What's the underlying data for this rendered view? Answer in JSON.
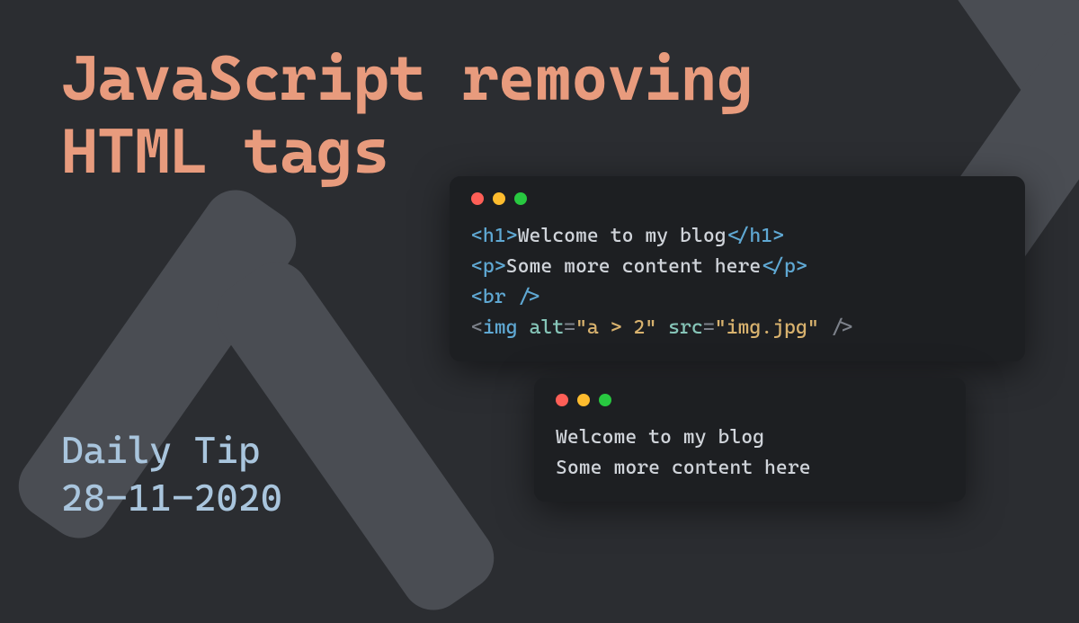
{
  "title_line1": "JavaScript removing",
  "title_line2": "HTML tags",
  "subtitle_line1": "Daily Tip",
  "subtitle_line2": "28-11-2020",
  "code_top": {
    "l1_open": "<h1>",
    "l1_text": "Welcome to my blog",
    "l1_close": "</h1>",
    "l2_open": "<p>",
    "l2_text": "Some more content here",
    "l2_close": "</p>",
    "l3": "<br />",
    "l4_open_lt": "<",
    "l4_tag": "img",
    "l4_sp1": " ",
    "l4_attr1": "alt",
    "l4_eq1": "=",
    "l4_val1": "\"a > 2\"",
    "l4_sp2": " ",
    "l4_attr2": "src",
    "l4_eq2": "=",
    "l4_val2": "\"img.jpg\"",
    "l4_close": " />"
  },
  "code_bottom": {
    "l1": "Welcome to my blog",
    "l2": "Some more content here"
  }
}
